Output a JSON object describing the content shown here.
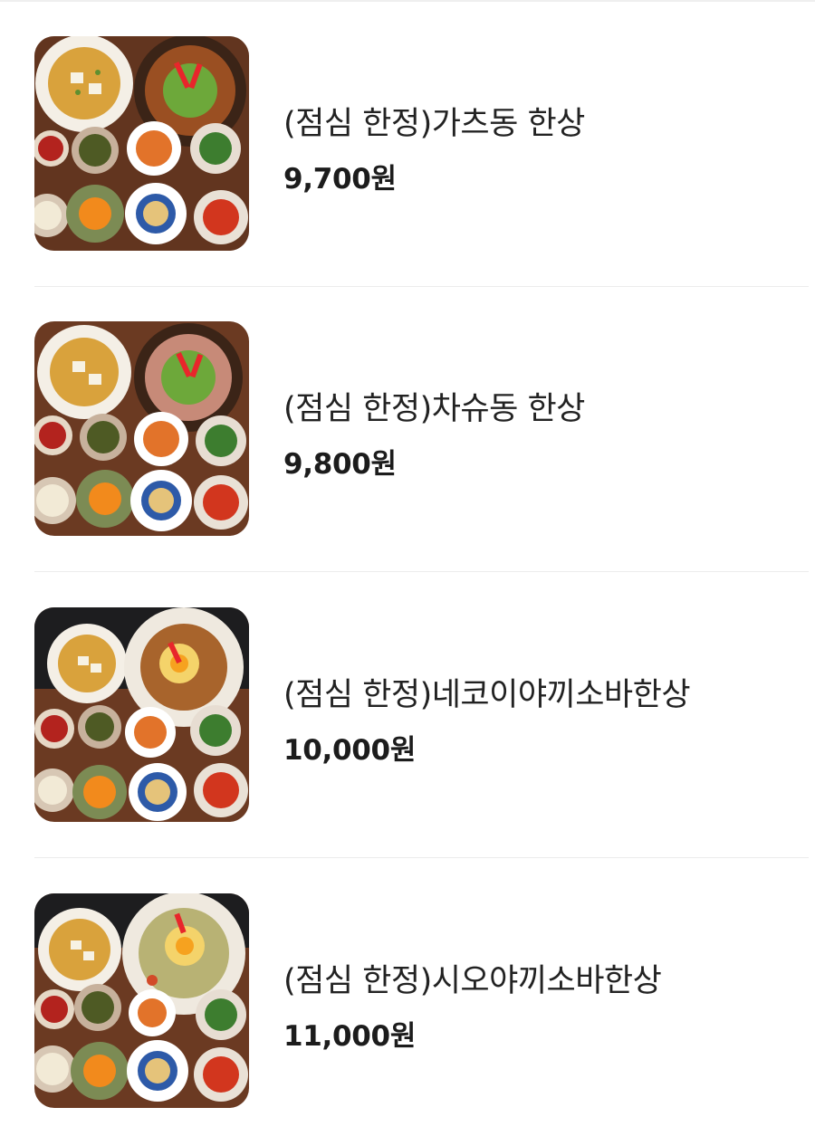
{
  "menu_items": [
    {
      "name": "(점심 한정)가츠동 한상",
      "price": "9,700원",
      "image": "gyudon-set-photo",
      "main_dish": "katsudon"
    },
    {
      "name": "(점심 한정)차슈동 한상",
      "price": "9,800원",
      "image": "chashu-set-photo",
      "main_dish": "chashudon"
    },
    {
      "name": "(점심 한정)네코이야끼소바한상",
      "price": "10,000원",
      "image": "yakisoba-set-photo",
      "main_dish": "yakisoba"
    },
    {
      "name": "(점심 한정)시오야끼소바한상",
      "price": "11,000원",
      "image": "shio-yakisoba-set-photo",
      "main_dish": "shio-yakisoba"
    }
  ]
}
